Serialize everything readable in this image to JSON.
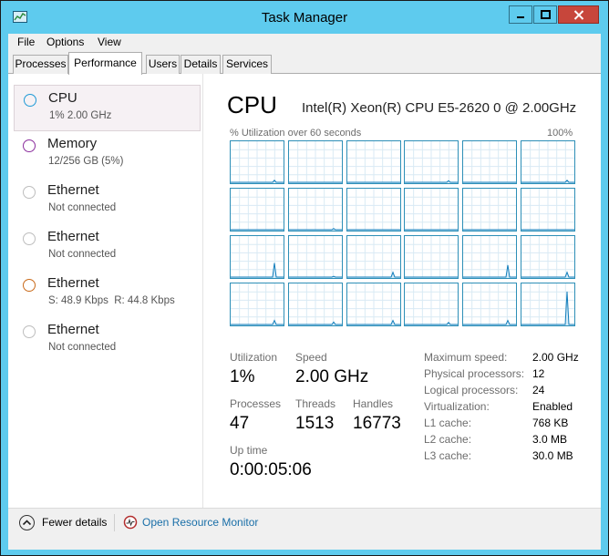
{
  "window": {
    "title": "Task Manager"
  },
  "menu": [
    "File",
    "Options",
    "View"
  ],
  "tabs": [
    {
      "label": "Processes",
      "active": false
    },
    {
      "label": "Performance",
      "active": true
    },
    {
      "label": "Users",
      "active": false
    },
    {
      "label": "Details",
      "active": false
    },
    {
      "label": "Services",
      "active": false
    }
  ],
  "sidebar": {
    "items": [
      {
        "title": "CPU",
        "sub": "1% 2.00 GHz",
        "color": "#1f9ad6",
        "selected": true
      },
      {
        "title": "Memory",
        "sub": "12/256 GB (5%)",
        "color": "#8b2e9d",
        "selected": false
      },
      {
        "title": "Ethernet",
        "sub": "Not connected",
        "color": "#bdbdbd",
        "selected": false
      },
      {
        "title": "Ethernet",
        "sub": "Not connected",
        "color": "#bdbdbd",
        "selected": false
      },
      {
        "title": "Ethernet",
        "sub": "S: 48.9 Kbps  R: 44.8 Kbps",
        "color": "#c96a1a",
        "selected": false
      },
      {
        "title": "Ethernet",
        "sub": "Not connected",
        "color": "#bdbdbd",
        "selected": false
      }
    ]
  },
  "cpu": {
    "heading": "CPU",
    "model": "Intel(R) Xeon(R) CPU E5-2620 0 @ 2.00GHz",
    "util_label": "% Utilization over 60 seconds",
    "util_max": "100%",
    "graph_color": "#117dbb",
    "graph_spikes": [
      0.05,
      0,
      0,
      0.04,
      0,
      0.05,
      0,
      0.03,
      0,
      0,
      0,
      0,
      0.35,
      0.02,
      0.12,
      0,
      0.3,
      0.12,
      0.1,
      0.06,
      0.1,
      0.05,
      0.1,
      0.82
    ]
  },
  "stats": {
    "utilization": {
      "label": "Utilization",
      "value": "1%"
    },
    "speed": {
      "label": "Speed",
      "value": "2.00 GHz"
    },
    "processes": {
      "label": "Processes",
      "value": "47"
    },
    "threads": {
      "label": "Threads",
      "value": "1513"
    },
    "handles": {
      "label": "Handles",
      "value": "16773"
    },
    "uptime": {
      "label": "Up time",
      "value": "0:00:05:06"
    }
  },
  "specs": [
    {
      "label": "Maximum speed:",
      "value": "2.00 GHz"
    },
    {
      "label": "Physical processors:",
      "value": "12"
    },
    {
      "label": "Logical processors:",
      "value": "24"
    },
    {
      "label": "Virtualization:",
      "value": "Enabled"
    },
    {
      "label": "L1 cache:",
      "value": "768 KB"
    },
    {
      "label": "L2 cache:",
      "value": "3.0 MB"
    },
    {
      "label": "L3 cache:",
      "value": "30.0 MB"
    }
  ],
  "footer": {
    "fewer_details": "Fewer details",
    "resource_monitor": "Open Resource Monitor"
  }
}
